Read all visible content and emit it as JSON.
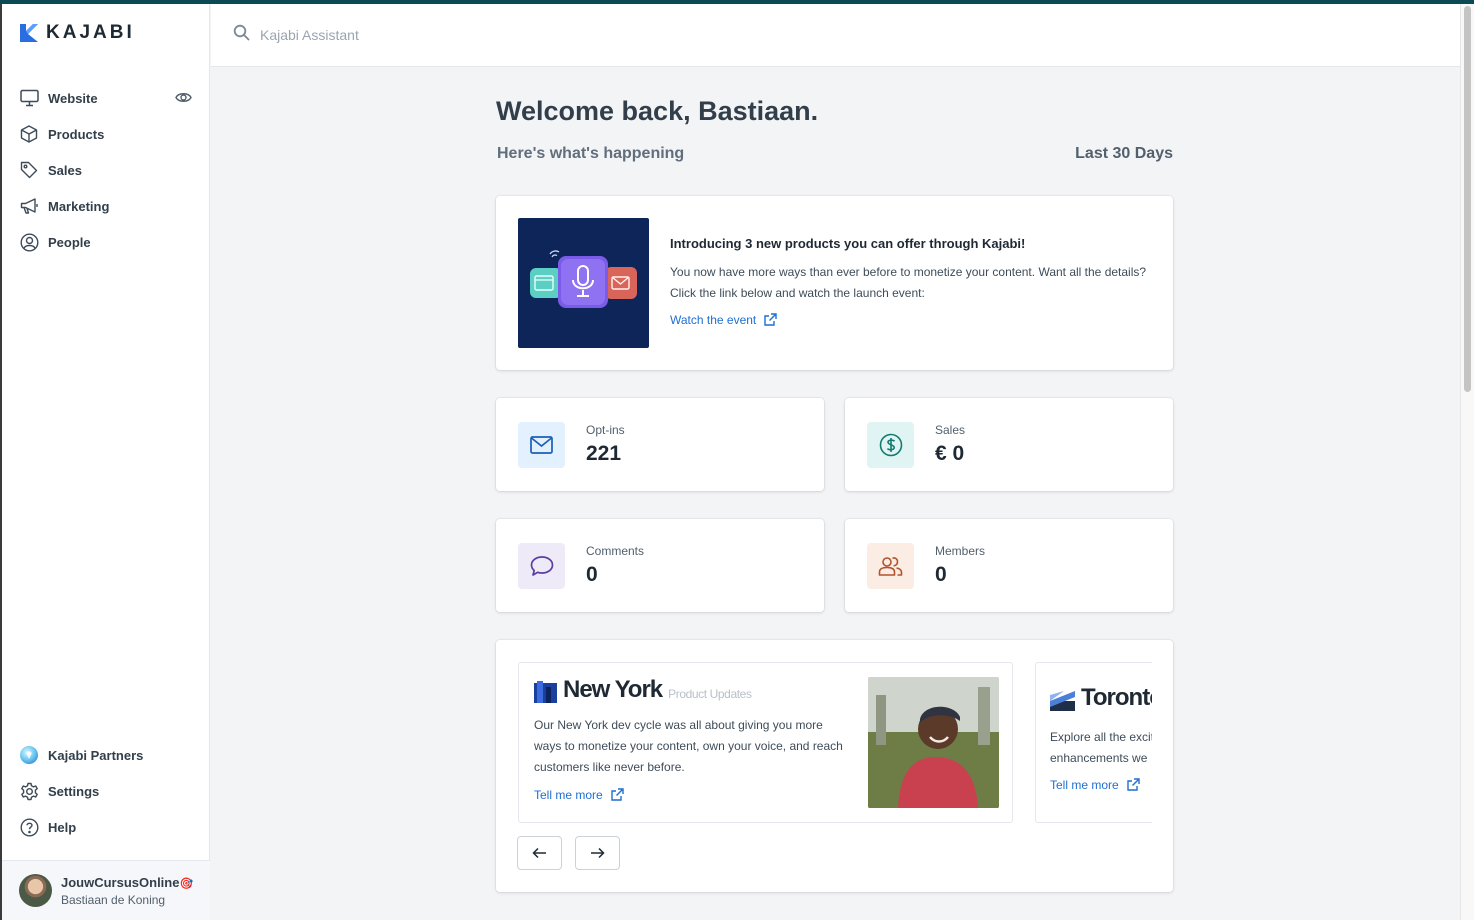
{
  "app": {
    "logo_text": "KAJABI",
    "accent_color": "#0c4a53",
    "brand_color": "#1f6fd1"
  },
  "sidebar": {
    "items": [
      {
        "label": "Website",
        "icon": "monitor-icon"
      },
      {
        "label": "Products",
        "icon": "box-icon"
      },
      {
        "label": "Sales",
        "icon": "tag-icon"
      },
      {
        "label": "Marketing",
        "icon": "megaphone-icon"
      },
      {
        "label": "People",
        "icon": "user-circle-icon"
      }
    ],
    "bottom_items": [
      {
        "label": "Kajabi Partners",
        "icon": "partners-icon"
      },
      {
        "label": "Settings",
        "icon": "gear-icon"
      },
      {
        "label": "Help",
        "icon": "help-icon"
      }
    ],
    "user": {
      "org": "JouwCursusOnline",
      "name": "Bastiaan de Koning",
      "org_emoji": "🎯"
    }
  },
  "search": {
    "placeholder": "Kajabi Assistant"
  },
  "main": {
    "welcome": "Welcome back, Bastiaan.",
    "subhead": "Here's what's happening",
    "range": "Last 30 Days",
    "promo": {
      "title": "Introducing 3 new products you can offer through Kajabi!",
      "body": "You now have more ways than ever before to monetize your content. Want all the details? Click the link below and watch the launch event:",
      "link": "Watch the event"
    },
    "stats": [
      {
        "label": "Opt-ins",
        "value": "221",
        "icon": "mail-icon",
        "bg": "#e3f0fd",
        "fg": "#1c5fb8"
      },
      {
        "label": "Sales",
        "value": "€ 0",
        "icon": "dollar-icon",
        "bg": "#e0f5f3",
        "fg": "#137a70"
      },
      {
        "label": "Comments",
        "value": "0",
        "icon": "comment-icon",
        "bg": "#efeaf8",
        "fg": "#5b3fa0"
      },
      {
        "label": "Members",
        "value": "0",
        "icon": "members-icon",
        "bg": "#fbece4",
        "fg": "#b2532c"
      }
    ],
    "updates": [
      {
        "brand": "New York",
        "brand_sub": "Product Updates",
        "text": "Our New York dev cycle was all about giving you more ways to monetize your content, own your voice, and reach customers like never before.",
        "link": "Tell me more"
      },
      {
        "brand": "Toronto",
        "text": "Explore all the exciting enhancements we",
        "link": "Tell me more"
      }
    ]
  }
}
